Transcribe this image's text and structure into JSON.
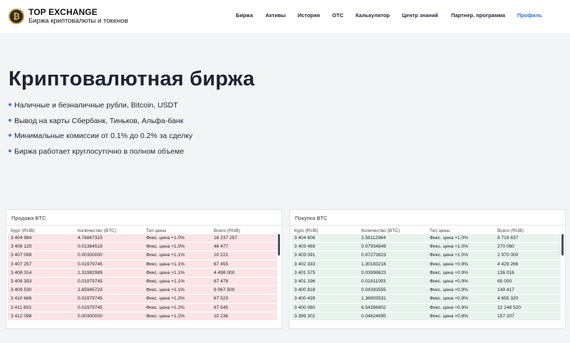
{
  "header": {
    "logo_glyph": "₿",
    "brand_title": "TOP EXCHANGE",
    "brand_subtitle": "Биржа криптовалюты и токенов",
    "nav": [
      {
        "label": "Биржа"
      },
      {
        "label": "Активы"
      },
      {
        "label": "История"
      },
      {
        "label": "OTC"
      },
      {
        "label": "Калькулятор"
      },
      {
        "label": "Центр знаний"
      },
      {
        "label": "Партнер. программа"
      },
      {
        "label": "Профиль"
      }
    ],
    "active_color": "#2f6fdc"
  },
  "hero": {
    "title": "Криптовалютная биржа",
    "bullets": [
      "Наличные и безналичные рубли, Bitcoin, USDT",
      "Вывод на карты Сбербанк, Тиньков, Альфа-банк",
      "Минимальные комиссии от 0.1% до 0.2% за сделку",
      "Биржа работает круглосуточно в полном объеме"
    ]
  },
  "sell": {
    "title": "Продажа BTC",
    "columns": [
      "Курс (RUB)",
      "Количество (BTC)",
      "Тип цены",
      "Всего (RUB)"
    ],
    "row_color": "#fbe4e6",
    "rows": [
      [
        "3 404 984",
        "4.76867315",
        "Фикс. цена +1.0%",
        "16 237 257"
      ],
      [
        "3 406 120",
        "0.01364519",
        "Фикс. цена +1.0%",
        "46 477"
      ],
      [
        "3 407 098",
        "0.00300000",
        "Фикс. цена +1.1%",
        "10 221"
      ],
      [
        "3 407 257",
        "0.01979745",
        "Фикс. цена +1.1%",
        "67 455"
      ],
      [
        "3 408 014",
        "1.31982989",
        "Фикс. цена +1.1%",
        "4 498 000"
      ],
      [
        "3 408 393",
        "0.01979745",
        "Фикс. цена +1.1%",
        "67 478"
      ],
      [
        "3 409 530",
        "2.65945723",
        "Фикс. цена +1.1%",
        "9 067 500"
      ],
      [
        "3 410 666",
        "0.01979745",
        "Фикс. цена +1.2%",
        "67 523"
      ],
      [
        "3 411 803",
        "0.01979745",
        "Фикс. цена +1.2%",
        "67 545"
      ],
      [
        "3 412 098",
        "0.00300000",
        "Фикс. цена +1.2%",
        "10 236"
      ]
    ]
  },
  "buy": {
    "title": "Покупка BTC",
    "columns": [
      "Курс (RUB)",
      "Количество (BTC)",
      "Тип цены",
      "Всего (RUB)"
    ],
    "row_color": "#e7f3ec",
    "rows": [
      [
        "3 404 606",
        "2.56112984",
        "Фикс. цена +1.0%",
        "8 719 637"
      ],
      [
        "3 403 469",
        "0.07934849",
        "Фикс. цена +1.0%",
        "270 060"
      ],
      [
        "3 403 091",
        "0.87273623",
        "Фикс. цена +1.0%",
        "2 970 000"
      ],
      [
        "3 402 333",
        "1.30183216",
        "Фикс. цена +0.9%",
        "4 429 266"
      ],
      [
        "3 401 575",
        "0.03998623",
        "Фикс. цена +0.9%",
        "136 016"
      ],
      [
        "3 401 196",
        "0.01911093",
        "Фикс. цена +0.9%",
        "65 000"
      ],
      [
        "3 400 818",
        "0.04393555",
        "Фикс. цена +0.9%",
        "149 417"
      ],
      [
        "3 400 439",
        "1.36903531",
        "Фикс. цена +0.9%",
        "4 655 320"
      ],
      [
        "3 400 060",
        "6.54356802",
        "Фикс. цена +0.9%",
        "22 248 520"
      ],
      [
        "3 399 302",
        "0.04624695",
        "Фикс. цена +0.8%",
        "157 207"
      ]
    ]
  }
}
